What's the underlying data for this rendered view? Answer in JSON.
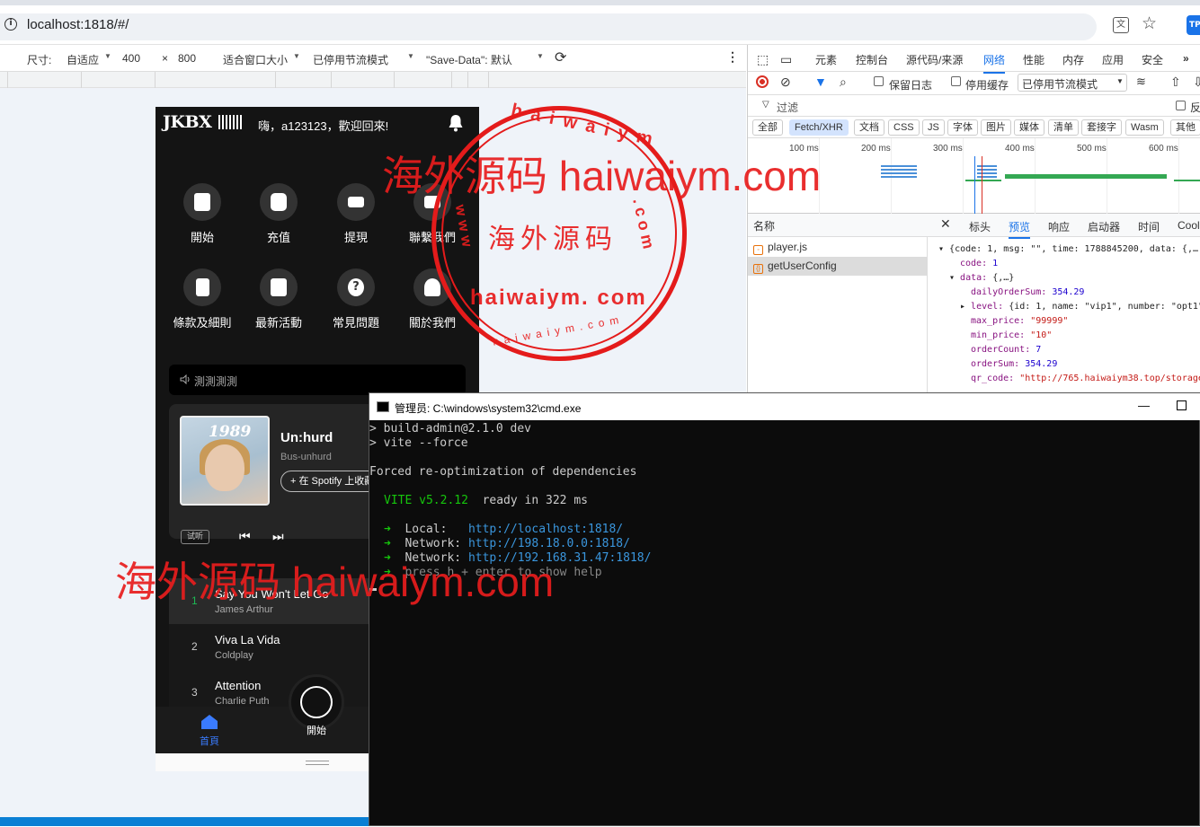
{
  "browser": {
    "url": "localhost:1818/#/"
  },
  "device_toolbar": {
    "size_label": "尺寸:",
    "mode": "自适应",
    "width": "400",
    "times": "×",
    "height": "800",
    "fit": "适合窗口大小",
    "throttle": "已停用节流模式",
    "save_data": "\"Save-Data\": 默认"
  },
  "phone": {
    "logo": "JKBX",
    "greeting": "嗨，a123123，歡迎回來!",
    "menu_row1": [
      "開始",
      "充值",
      "提現",
      "聯繫我們"
    ],
    "menu_row2": [
      "條款及細則",
      "最新活動",
      "常見問題",
      "關於我們"
    ],
    "announcement": "測測測測",
    "now_playing": {
      "album_text": "1989",
      "title": "Un:hurd",
      "artist": "Bus-unhurd",
      "spotify_button": "+ 在 Spotify 上收藏"
    },
    "preview_label": "试听",
    "tracks": [
      {
        "num": "1",
        "title": "Say You Won't Let Go",
        "artist": "James Arthur"
      },
      {
        "num": "2",
        "title": "Viva La Vida",
        "artist": "Coldplay"
      },
      {
        "num": "3",
        "title": "Attention",
        "artist": "Charlie Puth"
      }
    ],
    "tab_home": "首頁",
    "tab_start": "開始"
  },
  "devtools": {
    "tabs": [
      "元素",
      "控制台",
      "源代码/来源",
      "网络",
      "性能",
      "内存",
      "应用",
      "安全"
    ],
    "preserve_log": "保留日志",
    "disable_cache": "停用缓存",
    "throttle_select": "已停用节流模式",
    "filter_placeholder": "过滤",
    "invert": "反",
    "type_filters": [
      "全部",
      "Fetch/XHR",
      "文档",
      "CSS",
      "JS",
      "字体",
      "图片",
      "媒体",
      "清单",
      "套接字",
      "Wasm",
      "其他"
    ],
    "timeline_labels": [
      "100 ms",
      "200 ms",
      "300 ms",
      "400 ms",
      "500 ms",
      "600 ms"
    ],
    "list_header": "名称",
    "requests": [
      "player.js",
      "getUserConfig"
    ],
    "detail_tabs": [
      "标头",
      "预览",
      "响应",
      "启动器",
      "时间",
      "Cool"
    ],
    "preview": {
      "root": "{code: 1, msg: \"\", time: 1788845200, data: {,…",
      "code_key": "code:",
      "code_val": "1",
      "data_key": "data:",
      "data_val": "{,…}",
      "lines": [
        {
          "k": "dailyOrderSum:",
          "v": "354.29",
          "t": "num"
        },
        {
          "k": "level:",
          "v": "{id: 1, name: \"vip1\", number: \"opt1\"",
          "t": "obj"
        },
        {
          "k": "max_price:",
          "v": "\"99999\"",
          "t": "str"
        },
        {
          "k": "min_price:",
          "v": "\"10\"",
          "t": "str"
        },
        {
          "k": "orderCount:",
          "v": "7",
          "t": "num"
        },
        {
          "k": "orderSum:",
          "v": "354.29",
          "t": "num"
        },
        {
          "k": "qr_code:",
          "v": "\"http://765.haiwaiym38.top/storage",
          "t": "str"
        }
      ]
    }
  },
  "cmd": {
    "title": "管理员: C:\\windows\\system32\\cmd.exe",
    "line1": "> build-admin@2.1.0 dev",
    "line2": "> vite --force",
    "line3": "Forced re-optimization of dependencies",
    "vite_name": "VITE v5.2.12",
    "ready": "ready in 322 ms",
    "local_label": "Local:   ",
    "local_url": "http://localhost:1818/",
    "net_label": "Network: ",
    "net_url1": "http://198.18.0.0:1818/",
    "net_url2": "http://192.168.31.47:1818/",
    "help": "press h + enter to show help",
    "bullet": "➜"
  },
  "watermark": {
    "top": "海外源码 haiwaiym.com",
    "bottom": "海外源码 haiwaiym.com",
    "stamp_center": "海外源码",
    "stamp_url": "haiwaiym. com",
    "stamp_ring_top": "haiwaiym",
    "stamp_ring_side": ".com",
    "stamp_ring_left": "www",
    "stamp_ring_bottom": "haiwaiym.com"
  },
  "colors": {
    "accent_blue": "#1a73e8",
    "watermark_red": "#e81d1d",
    "vite_green": "#16c60c"
  }
}
